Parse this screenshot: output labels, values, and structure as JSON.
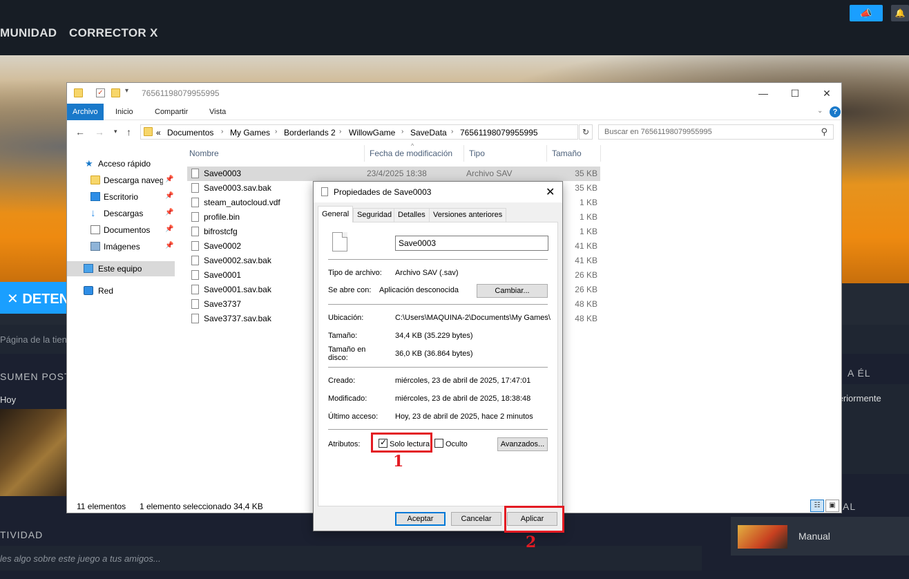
{
  "steam": {
    "nav": [
      "MUNIDAD",
      "CORRECTOR X"
    ],
    "install_label": "✕ DETEN",
    "hub_text": "Página de la tienda",
    "summary_head": "SUMEN POST",
    "today": "Hoy",
    "right_head": "A ÉL",
    "right_text": "teriormente",
    "right_head2": "AL",
    "activity_head": "TIVIDAD",
    "activity_prompt": "les algo sobre este juego a tus amigos...",
    "manual_label": "Manual"
  },
  "explorer": {
    "title": "76561198079955995",
    "ribbon_tabs": [
      "Archivo",
      "Inicio",
      "Compartir",
      "Vista"
    ],
    "breadcrumb": [
      "«",
      "Documentos",
      "My Games",
      "Borderlands 2",
      "WillowGame",
      "SaveData",
      "76561198079955995"
    ],
    "search_placeholder": "Buscar en 76561198079955995",
    "nav_items": [
      {
        "label": "Acceso rápido"
      },
      {
        "label": "Descarga navegador"
      },
      {
        "label": "Escritorio"
      },
      {
        "label": "Descargas"
      },
      {
        "label": "Documentos"
      },
      {
        "label": "Imágenes"
      },
      {
        "label": "Este equipo"
      },
      {
        "label": "Red"
      }
    ],
    "columns": [
      "Nombre",
      "Fecha de modificación",
      "Tipo",
      "Tamaño"
    ],
    "files": [
      {
        "name": "Save0003",
        "date": "23/4/2025 18:38",
        "type": "Archivo SAV",
        "size": "35 KB"
      },
      {
        "name": "Save0003.sav.bak",
        "date": "",
        "type": "",
        "size": "35 KB"
      },
      {
        "name": "steam_autocloud.vdf",
        "date": "",
        "type": "",
        "size": "1 KB"
      },
      {
        "name": "profile.bin",
        "date": "",
        "type": "",
        "size": "1 KB"
      },
      {
        "name": "bifrostcfg",
        "date": "",
        "type": "",
        "size": "1 KB"
      },
      {
        "name": "Save0002",
        "date": "",
        "type": "",
        "size": "41 KB"
      },
      {
        "name": "Save0002.sav.bak",
        "date": "",
        "type": "",
        "size": "41 KB"
      },
      {
        "name": "Save0001",
        "date": "",
        "type": "",
        "size": "26 KB"
      },
      {
        "name": "Save0001.sav.bak",
        "date": "",
        "type": "",
        "size": "26 KB"
      },
      {
        "name": "Save3737",
        "date": "",
        "type": "",
        "size": "48 KB"
      },
      {
        "name": "Save3737.sav.bak",
        "date": "",
        "type": "",
        "size": "48 KB"
      }
    ],
    "status_count": "11 elementos",
    "status_selection": "1 elemento seleccionado  34,4 KB"
  },
  "dialog": {
    "title": "Propiedades de Save0003",
    "tabs": [
      "General",
      "Seguridad",
      "Detalles",
      "Versiones anteriores"
    ],
    "filename": "Save0003",
    "labels": {
      "type": "Tipo de archivo:",
      "opens_with": "Se abre con:",
      "location": "Ubicación:",
      "size": "Tamaño:",
      "size_on_disk": "Tamaño en disco:",
      "created": "Creado:",
      "modified": "Modificado:",
      "accessed": "Último acceso:",
      "attributes": "Atributos:"
    },
    "values": {
      "type": "Archivo SAV (.sav)",
      "opens_with": "Aplicación desconocida",
      "location": "C:\\Users\\MAQUINA-2\\Documents\\My Games\\",
      "size": "34,4 KB (35.229 bytes)",
      "size_on_disk": "36,0 KB (36.864 bytes)",
      "created": "miércoles, 23 de abril de 2025, 17:47:01",
      "modified": "miércoles, 23 de abril de 2025, 18:38:48",
      "accessed": "Hoy, 23 de abril de 2025, hace 2 minutos"
    },
    "change_button": "Cambiar...",
    "readonly_label": "Solo lectura",
    "hidden_label": "Oculto",
    "advanced_button": "Avanzados...",
    "ok_button": "Aceptar",
    "cancel_button": "Cancelar",
    "apply_button": "Aplicar",
    "readonly_checked": true,
    "hidden_checked": false
  },
  "annotations": {
    "step1": "1",
    "step2": "2",
    "color": "#e31b23"
  }
}
